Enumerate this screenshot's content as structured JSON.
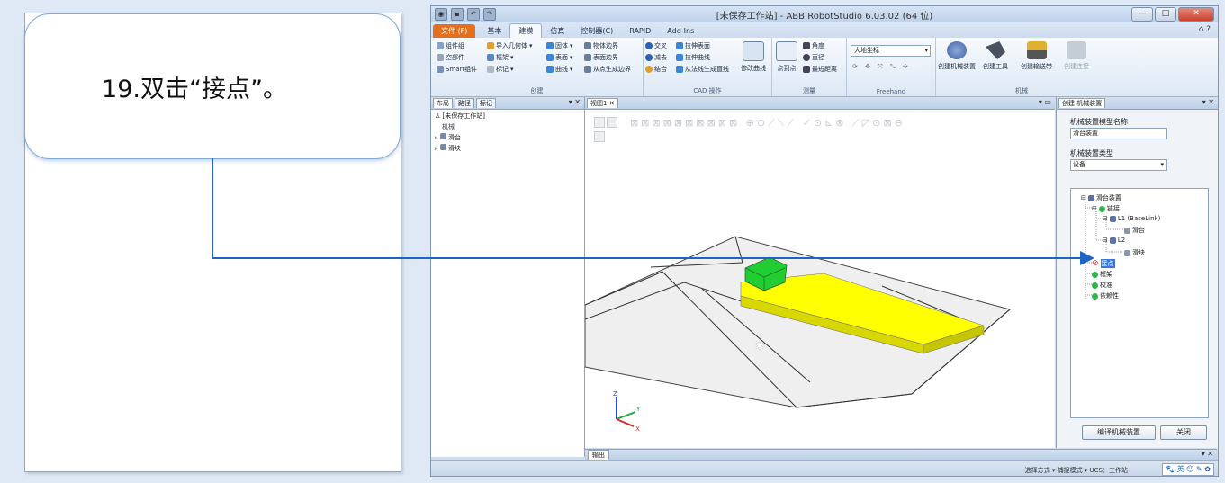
{
  "instruction": {
    "text": "19.双击“接点”。"
  },
  "window": {
    "title": "[未保存工作站] - ABB RobotStudio 6.03.02 (64 位)",
    "buttons": [
      "—",
      "□",
      "✕"
    ]
  },
  "ribbon_tabs": [
    "文件 (F)",
    "基本",
    "建模",
    "仿真",
    "控制器(C)",
    "RAPID",
    "Add-Ins"
  ],
  "active_tab": "建模",
  "ribbon": {
    "create_group": {
      "label": "创建",
      "items": [
        "组件组",
        "空部件",
        "Smart组件",
        "导入几何体",
        "框架",
        "标记"
      ]
    },
    "shape_items": [
      "固体",
      "表面",
      "曲线",
      "物体边界",
      "表面边界",
      "从点生成边界"
    ],
    "cad_group": {
      "label": "CAD 操作",
      "items": [
        "交叉",
        "减去",
        "结合",
        "拉伸表面",
        "拉伸曲线",
        "从法线生成直线"
      ],
      "big": "修改曲线"
    },
    "measure_group": {
      "label": "测量",
      "items": [
        "角度",
        "直径",
        "最短距离"
      ],
      "big": "点到点"
    },
    "freehand_group": {
      "label": "Freehand",
      "combo": "大地坐标"
    },
    "mech_group": {
      "label": "机械",
      "buttons": [
        "创建机械装置",
        "创建工具",
        "创建输送带",
        "创建连接"
      ]
    }
  },
  "left_pane": {
    "tabs": [
      "布局",
      "路径",
      "标记"
    ],
    "tree": [
      "[未保存工作站]",
      "机械",
      "滑台",
      "滑块"
    ]
  },
  "view": {
    "tab": "视图1"
  },
  "output": {
    "tab": "输出"
  },
  "right_pane": {
    "tab": "创建 机械装置",
    "model_name_label": "机械装置模型名称",
    "model_name_value": "滑台装置",
    "type_label": "机械装置类型",
    "type_value": "设备",
    "tree": {
      "root": "滑台装置",
      "links": "链接",
      "l1": "L1 (BaseLink)",
      "l1_child": "滑台",
      "l2": "L2",
      "l2_child": "滑块",
      "joints": "接点",
      "frames": "框架",
      "calibration": "校准",
      "dependency": "依赖性"
    },
    "compile_button": "编译机械装置",
    "close_button": "关闭"
  },
  "status": {
    "text": "选择方式 ▾ 捕捉模式 ▾ UCS：工作站",
    "ime": "英"
  },
  "colors": {
    "accent": "#1f63c6",
    "file_tab": "#e46f1f",
    "rail": "#ffff00",
    "slider": "#22cc33",
    "error": "#d62b2b"
  }
}
